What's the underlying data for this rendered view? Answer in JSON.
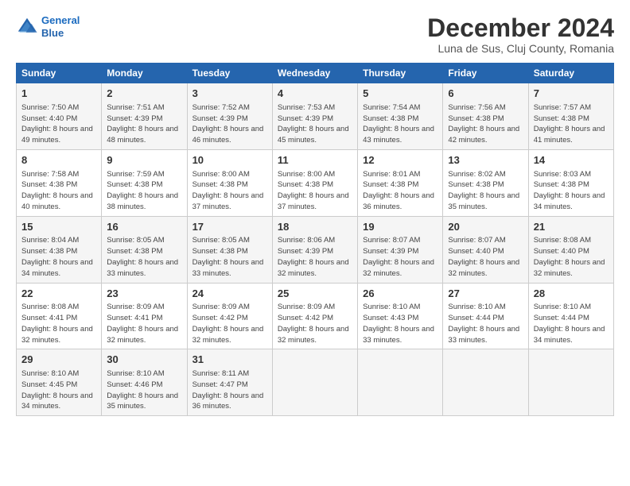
{
  "header": {
    "logo_line1": "General",
    "logo_line2": "Blue",
    "title": "December 2024",
    "subtitle": "Luna de Sus, Cluj County, Romania"
  },
  "columns": [
    "Sunday",
    "Monday",
    "Tuesday",
    "Wednesday",
    "Thursday",
    "Friday",
    "Saturday"
  ],
  "weeks": [
    [
      {
        "day": "1",
        "sunrise": "Sunrise: 7:50 AM",
        "sunset": "Sunset: 4:40 PM",
        "daylight": "Daylight: 8 hours and 49 minutes."
      },
      {
        "day": "2",
        "sunrise": "Sunrise: 7:51 AM",
        "sunset": "Sunset: 4:39 PM",
        "daylight": "Daylight: 8 hours and 48 minutes."
      },
      {
        "day": "3",
        "sunrise": "Sunrise: 7:52 AM",
        "sunset": "Sunset: 4:39 PM",
        "daylight": "Daylight: 8 hours and 46 minutes."
      },
      {
        "day": "4",
        "sunrise": "Sunrise: 7:53 AM",
        "sunset": "Sunset: 4:39 PM",
        "daylight": "Daylight: 8 hours and 45 minutes."
      },
      {
        "day": "5",
        "sunrise": "Sunrise: 7:54 AM",
        "sunset": "Sunset: 4:38 PM",
        "daylight": "Daylight: 8 hours and 43 minutes."
      },
      {
        "day": "6",
        "sunrise": "Sunrise: 7:56 AM",
        "sunset": "Sunset: 4:38 PM",
        "daylight": "Daylight: 8 hours and 42 minutes."
      },
      {
        "day": "7",
        "sunrise": "Sunrise: 7:57 AM",
        "sunset": "Sunset: 4:38 PM",
        "daylight": "Daylight: 8 hours and 41 minutes."
      }
    ],
    [
      {
        "day": "8",
        "sunrise": "Sunrise: 7:58 AM",
        "sunset": "Sunset: 4:38 PM",
        "daylight": "Daylight: 8 hours and 40 minutes."
      },
      {
        "day": "9",
        "sunrise": "Sunrise: 7:59 AM",
        "sunset": "Sunset: 4:38 PM",
        "daylight": "Daylight: 8 hours and 38 minutes."
      },
      {
        "day": "10",
        "sunrise": "Sunrise: 8:00 AM",
        "sunset": "Sunset: 4:38 PM",
        "daylight": "Daylight: 8 hours and 37 minutes."
      },
      {
        "day": "11",
        "sunrise": "Sunrise: 8:00 AM",
        "sunset": "Sunset: 4:38 PM",
        "daylight": "Daylight: 8 hours and 37 minutes."
      },
      {
        "day": "12",
        "sunrise": "Sunrise: 8:01 AM",
        "sunset": "Sunset: 4:38 PM",
        "daylight": "Daylight: 8 hours and 36 minutes."
      },
      {
        "day": "13",
        "sunrise": "Sunrise: 8:02 AM",
        "sunset": "Sunset: 4:38 PM",
        "daylight": "Daylight: 8 hours and 35 minutes."
      },
      {
        "day": "14",
        "sunrise": "Sunrise: 8:03 AM",
        "sunset": "Sunset: 4:38 PM",
        "daylight": "Daylight: 8 hours and 34 minutes."
      }
    ],
    [
      {
        "day": "15",
        "sunrise": "Sunrise: 8:04 AM",
        "sunset": "Sunset: 4:38 PM",
        "daylight": "Daylight: 8 hours and 34 minutes."
      },
      {
        "day": "16",
        "sunrise": "Sunrise: 8:05 AM",
        "sunset": "Sunset: 4:38 PM",
        "daylight": "Daylight: 8 hours and 33 minutes."
      },
      {
        "day": "17",
        "sunrise": "Sunrise: 8:05 AM",
        "sunset": "Sunset: 4:38 PM",
        "daylight": "Daylight: 8 hours and 33 minutes."
      },
      {
        "day": "18",
        "sunrise": "Sunrise: 8:06 AM",
        "sunset": "Sunset: 4:39 PM",
        "daylight": "Daylight: 8 hours and 32 minutes."
      },
      {
        "day": "19",
        "sunrise": "Sunrise: 8:07 AM",
        "sunset": "Sunset: 4:39 PM",
        "daylight": "Daylight: 8 hours and 32 minutes."
      },
      {
        "day": "20",
        "sunrise": "Sunrise: 8:07 AM",
        "sunset": "Sunset: 4:40 PM",
        "daylight": "Daylight: 8 hours and 32 minutes."
      },
      {
        "day": "21",
        "sunrise": "Sunrise: 8:08 AM",
        "sunset": "Sunset: 4:40 PM",
        "daylight": "Daylight: 8 hours and 32 minutes."
      }
    ],
    [
      {
        "day": "22",
        "sunrise": "Sunrise: 8:08 AM",
        "sunset": "Sunset: 4:41 PM",
        "daylight": "Daylight: 8 hours and 32 minutes."
      },
      {
        "day": "23",
        "sunrise": "Sunrise: 8:09 AM",
        "sunset": "Sunset: 4:41 PM",
        "daylight": "Daylight: 8 hours and 32 minutes."
      },
      {
        "day": "24",
        "sunrise": "Sunrise: 8:09 AM",
        "sunset": "Sunset: 4:42 PM",
        "daylight": "Daylight: 8 hours and 32 minutes."
      },
      {
        "day": "25",
        "sunrise": "Sunrise: 8:09 AM",
        "sunset": "Sunset: 4:42 PM",
        "daylight": "Daylight: 8 hours and 32 minutes."
      },
      {
        "day": "26",
        "sunrise": "Sunrise: 8:10 AM",
        "sunset": "Sunset: 4:43 PM",
        "daylight": "Daylight: 8 hours and 33 minutes."
      },
      {
        "day": "27",
        "sunrise": "Sunrise: 8:10 AM",
        "sunset": "Sunset: 4:44 PM",
        "daylight": "Daylight: 8 hours and 33 minutes."
      },
      {
        "day": "28",
        "sunrise": "Sunrise: 8:10 AM",
        "sunset": "Sunset: 4:44 PM",
        "daylight": "Daylight: 8 hours and 34 minutes."
      }
    ],
    [
      {
        "day": "29",
        "sunrise": "Sunrise: 8:10 AM",
        "sunset": "Sunset: 4:45 PM",
        "daylight": "Daylight: 8 hours and 34 minutes."
      },
      {
        "day": "30",
        "sunrise": "Sunrise: 8:10 AM",
        "sunset": "Sunset: 4:46 PM",
        "daylight": "Daylight: 8 hours and 35 minutes."
      },
      {
        "day": "31",
        "sunrise": "Sunrise: 8:11 AM",
        "sunset": "Sunset: 4:47 PM",
        "daylight": "Daylight: 8 hours and 36 minutes."
      },
      null,
      null,
      null,
      null
    ]
  ]
}
